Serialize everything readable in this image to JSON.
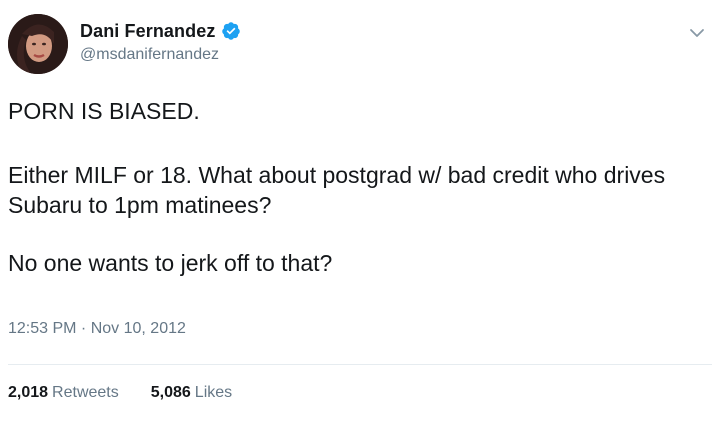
{
  "user": {
    "display_name": "Dani Fernandez",
    "handle": "@msdanifernandez",
    "verified": true
  },
  "icons": {
    "verified": "verified-badge-icon",
    "caret": "chevron-down-icon"
  },
  "colors": {
    "verified_blue": "#1da1f2",
    "secondary_text": "#657786",
    "primary_text": "#14171a",
    "divider": "#e6ecf0"
  },
  "tweet": {
    "paragraphs": [
      "PORN IS BIASED.",
      "Either MILF or 18. What about postgrad w/ bad credit who drives Subaru to 1pm matinees?",
      "No one wants to jerk off to that?"
    ],
    "timestamp": "12:53 PM · Nov 10, 2012"
  },
  "stats": {
    "retweets_count": "2,018",
    "retweets_label": "Retweets",
    "likes_count": "5,086",
    "likes_label": "Likes"
  }
}
